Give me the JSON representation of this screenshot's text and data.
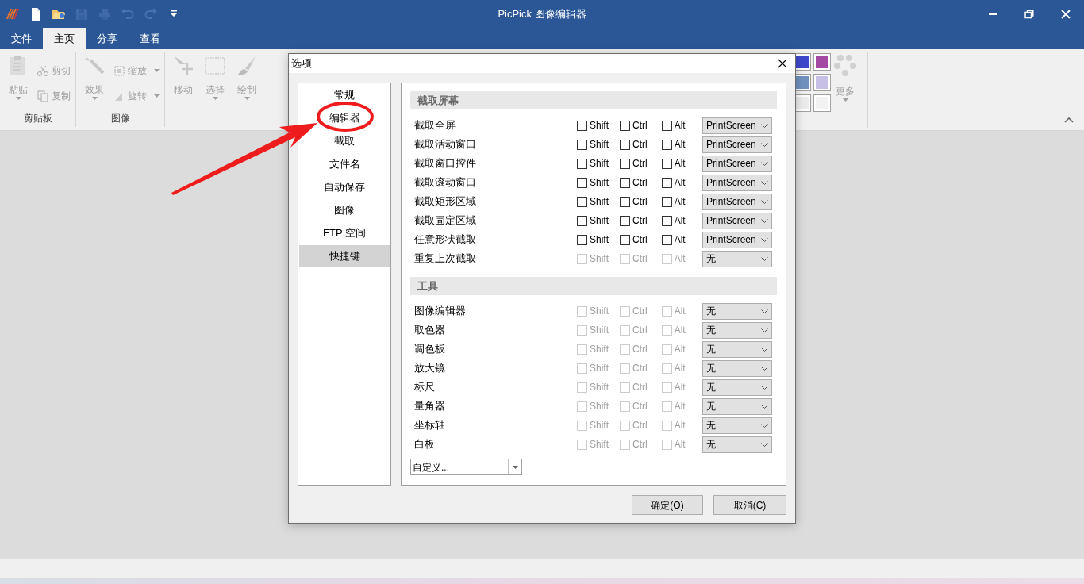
{
  "window": {
    "title": "PicPick 图像编辑器"
  },
  "quick_access": [
    {
      "kind": "logo"
    },
    {
      "kind": "new",
      "disabled": false
    },
    {
      "kind": "open",
      "disabled": false
    },
    {
      "kind": "save",
      "disabled": true
    },
    {
      "kind": "print",
      "disabled": true
    },
    {
      "kind": "undo",
      "disabled": true
    },
    {
      "kind": "redo",
      "disabled": true
    },
    {
      "kind": "customize"
    }
  ],
  "tabs": [
    {
      "label": "文件",
      "selected": false
    },
    {
      "label": "主页",
      "selected": true
    },
    {
      "label": "分享",
      "selected": false
    },
    {
      "label": "查看",
      "selected": false
    }
  ],
  "ribbon": {
    "groups": [
      {
        "label": "剪贴板",
        "items": [
          {
            "kind": "large",
            "label": "粘贴",
            "menu": true,
            "disabled": true
          },
          {
            "kind": "small",
            "label": "剪切",
            "menu": false,
            "disabled": true
          },
          {
            "kind": "small",
            "label": "复制",
            "menu": false,
            "disabled": true
          }
        ]
      },
      {
        "label": "图像",
        "items": [
          {
            "kind": "large",
            "label": "效果",
            "menu": true,
            "disabled": true
          },
          {
            "kind": "small",
            "label": "缩放",
            "menu": true,
            "disabled": true
          },
          {
            "kind": "small",
            "label": "旋转",
            "menu": true,
            "disabled": true
          }
        ]
      },
      {
        "items": [
          {
            "kind": "large",
            "label": "移动",
            "menu": false,
            "disabled": true
          },
          {
            "kind": "large",
            "label": "选择",
            "menu": true,
            "disabled": true
          },
          {
            "kind": "large",
            "label": "绘制",
            "menu": true,
            "disabled": true
          }
        ]
      }
    ],
    "palette": [
      {
        "color": "#3f48cc"
      },
      {
        "color": "#a349a4"
      },
      {
        "color": "#7092be"
      },
      {
        "color": "#c8bfe7"
      },
      {
        "color": "#ececec"
      },
      {
        "color": "#f2f2f2"
      }
    ],
    "more": {
      "label": "更多",
      "menu": true,
      "disabled": true
    }
  },
  "dialog": {
    "title": "选项",
    "nav": [
      {
        "label": "常规",
        "selected": false
      },
      {
        "label": "编辑器",
        "selected": false
      },
      {
        "label": "截取",
        "selected": false
      },
      {
        "label": "文件名",
        "selected": false
      },
      {
        "label": "自动保存",
        "selected": false
      },
      {
        "label": "图像",
        "selected": false
      },
      {
        "label": "FTP 空间",
        "selected": false
      },
      {
        "label": "快捷键",
        "selected": true
      }
    ],
    "sections": [
      {
        "title": "截取屏幕",
        "rows": [
          {
            "label": "截取全屏",
            "disabled": false,
            "modifiers": [
              {
                "label": "Shift",
                "checked": false
              },
              {
                "label": "Ctrl",
                "checked": false
              },
              {
                "label": "Alt",
                "checked": false
              }
            ],
            "key": "PrintScreen"
          },
          {
            "label": "截取活动窗口",
            "disabled": false,
            "modifiers": [
              {
                "label": "Shift",
                "checked": false
              },
              {
                "label": "Ctrl",
                "checked": false
              },
              {
                "label": "Alt",
                "checked": false
              }
            ],
            "key": "PrintScreen"
          },
          {
            "label": "截取窗口控件",
            "disabled": false,
            "modifiers": [
              {
                "label": "Shift",
                "checked": false
              },
              {
                "label": "Ctrl",
                "checked": false
              },
              {
                "label": "Alt",
                "checked": false
              }
            ],
            "key": "PrintScreen"
          },
          {
            "label": "截取滚动窗口",
            "disabled": false,
            "modifiers": [
              {
                "label": "Shift",
                "checked": false
              },
              {
                "label": "Ctrl",
                "checked": false
              },
              {
                "label": "Alt",
                "checked": false
              }
            ],
            "key": "PrintScreen"
          },
          {
            "label": "截取矩形区域",
            "disabled": false,
            "modifiers": [
              {
                "label": "Shift",
                "checked": false
              },
              {
                "label": "Ctrl",
                "checked": false
              },
              {
                "label": "Alt",
                "checked": false
              }
            ],
            "key": "PrintScreen"
          },
          {
            "label": "截取固定区域",
            "disabled": false,
            "modifiers": [
              {
                "label": "Shift",
                "checked": false
              },
              {
                "label": "Ctrl",
                "checked": false
              },
              {
                "label": "Alt",
                "checked": false
              }
            ],
            "key": "PrintScreen"
          },
          {
            "label": "任意形状截取",
            "disabled": false,
            "modifiers": [
              {
                "label": "Shift",
                "checked": false
              },
              {
                "label": "Ctrl",
                "checked": false
              },
              {
                "label": "Alt",
                "checked": false
              }
            ],
            "key": "PrintScreen"
          },
          {
            "label": "重复上次截取",
            "disabled": true,
            "modifiers": [
              {
                "label": "Shift",
                "checked": false
              },
              {
                "label": "Ctrl",
                "checked": false
              },
              {
                "label": "Alt",
                "checked": false
              }
            ],
            "key": "无"
          }
        ]
      },
      {
        "title": "工具",
        "rows": [
          {
            "label": "图像编辑器",
            "disabled": true,
            "modifiers": [
              {
                "label": "Shift",
                "checked": false
              },
              {
                "label": "Ctrl",
                "checked": false
              },
              {
                "label": "Alt",
                "checked": false
              }
            ],
            "key": "无"
          },
          {
            "label": "取色器",
            "disabled": true,
            "modifiers": [
              {
                "label": "Shift",
                "checked": false
              },
              {
                "label": "Ctrl",
                "checked": false
              },
              {
                "label": "Alt",
                "checked": false
              }
            ],
            "key": "无"
          },
          {
            "label": "调色板",
            "disabled": true,
            "modifiers": [
              {
                "label": "Shift",
                "checked": false
              },
              {
                "label": "Ctrl",
                "checked": false
              },
              {
                "label": "Alt",
                "checked": false
              }
            ],
            "key": "无"
          },
          {
            "label": "放大镜",
            "disabled": true,
            "modifiers": [
              {
                "label": "Shift",
                "checked": false
              },
              {
                "label": "Ctrl",
                "checked": false
              },
              {
                "label": "Alt",
                "checked": false
              }
            ],
            "key": "无"
          },
          {
            "label": "标尺",
            "disabled": true,
            "modifiers": [
              {
                "label": "Shift",
                "checked": false
              },
              {
                "label": "Ctrl",
                "checked": false
              },
              {
                "label": "Alt",
                "checked": false
              }
            ],
            "key": "无"
          },
          {
            "label": "量角器",
            "disabled": true,
            "modifiers": [
              {
                "label": "Shift",
                "checked": false
              },
              {
                "label": "Ctrl",
                "checked": false
              },
              {
                "label": "Alt",
                "checked": false
              }
            ],
            "key": "无"
          },
          {
            "label": "坐标轴",
            "disabled": true,
            "modifiers": [
              {
                "label": "Shift",
                "checked": false
              },
              {
                "label": "Ctrl",
                "checked": false
              },
              {
                "label": "Alt",
                "checked": false
              }
            ],
            "key": "无"
          },
          {
            "label": "白板",
            "disabled": true,
            "modifiers": [
              {
                "label": "Shift",
                "checked": false
              },
              {
                "label": "Ctrl",
                "checked": false
              },
              {
                "label": "Alt",
                "checked": false
              }
            ],
            "key": "无"
          }
        ]
      }
    ],
    "preset": {
      "value": "自定义..."
    },
    "buttons": [
      "确定(O)",
      "取消(C)"
    ]
  },
  "annotations": [
    {
      "kind": "ellipse"
    },
    {
      "kind": "arrow"
    }
  ]
}
